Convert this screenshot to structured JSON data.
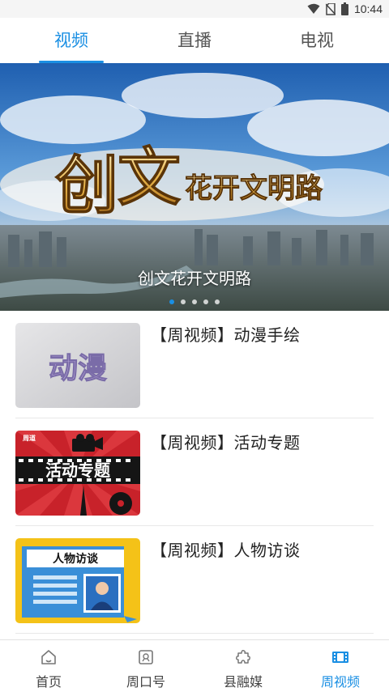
{
  "status_bar": {
    "time": "10:44",
    "icons": [
      "wifi-icon",
      "no-sim-icon",
      "battery-icon"
    ]
  },
  "top_tabs": [
    {
      "label": "视频",
      "active": true
    },
    {
      "label": "直播",
      "active": false
    },
    {
      "label": "电视",
      "active": false
    }
  ],
  "banner": {
    "logo_big_chars": [
      "创",
      "文"
    ],
    "logo_small_text": "花开文明路",
    "caption": "创文花开文明路",
    "dot_count": 5,
    "active_dot": 0
  },
  "video_list": [
    {
      "title": "【周视频】动漫手绘",
      "thumb_text": "动漫"
    },
    {
      "title": "【周视频】活动专题",
      "thumb_text": "活动专题",
      "thumb_badge": "周道"
    },
    {
      "title": "【周视频】人物访谈",
      "thumb_text": "人物访谈"
    }
  ],
  "bottom_nav": [
    {
      "label": "首页",
      "icon": "home-icon",
      "active": false
    },
    {
      "label": "周口号",
      "icon": "account-badge-icon",
      "active": false
    },
    {
      "label": "县融媒",
      "icon": "puzzle-icon",
      "active": false
    },
    {
      "label": "周视频",
      "icon": "film-icon",
      "active": true
    }
  ],
  "colors": {
    "accent": "#1a8fe3",
    "text": "#222222",
    "inactive": "#555555"
  }
}
